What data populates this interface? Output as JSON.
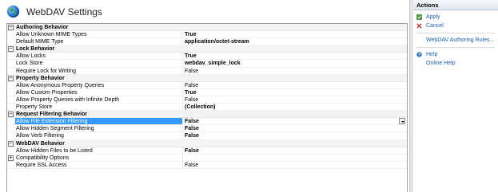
{
  "header": {
    "title": "WebDAV Settings"
  },
  "grid": {
    "categories": [
      {
        "label": "Authoring Behavior",
        "props": [
          {
            "name": "Allow Unknown MIME Types",
            "value": "True",
            "bold": true
          },
          {
            "name": "Default MIME Type",
            "value": "application/octet-stream",
            "bold": true
          }
        ]
      },
      {
        "label": "Lock Behavior",
        "props": [
          {
            "name": "Allow Locks",
            "value": "True",
            "bold": true
          },
          {
            "name": "Lock Store",
            "value": "webdav_simple_lock",
            "bold": true
          },
          {
            "name": "Require Lock for Writing",
            "value": "False",
            "bold": false
          }
        ]
      },
      {
        "label": "Property Behavior",
        "props": [
          {
            "name": "Allow Anonymous Property Queries",
            "value": "False",
            "bold": false
          },
          {
            "name": "Allow Custom Properties",
            "value": "True",
            "bold": true
          },
          {
            "name": "Allow Property Queries with Infinite Depth",
            "value": "False",
            "bold": false
          },
          {
            "name": "Property Store",
            "value": "(Collection)",
            "bold": true
          }
        ]
      },
      {
        "label": "Request Filtering Behavior",
        "props": [
          {
            "name": "Allow File Extension Filtering",
            "value": "False",
            "bold": true,
            "selected": true
          },
          {
            "name": "Allow Hidden Segment Filtering",
            "value": "False",
            "bold": true
          },
          {
            "name": "Allow Verb Filtering",
            "value": "False",
            "bold": true
          }
        ]
      },
      {
        "label": "WebDAV Behavior",
        "props": [
          {
            "name": "Allow Hidden Files to be Listed",
            "value": "False",
            "bold": true
          },
          {
            "name": "Compatibility Options",
            "value": "",
            "bold": false,
            "expandable": true
          },
          {
            "name": "Require SSL Access",
            "value": "False",
            "bold": false
          }
        ]
      }
    ]
  },
  "actions": {
    "title": "Actions",
    "apply": "Apply",
    "cancel": "Cancel",
    "authoring_rules": "WebDAV Authoring Rules...",
    "help": "Help",
    "online_help": "Online Help"
  },
  "colors": {
    "selection": "#3399ff",
    "link": "#1a5fb4",
    "category_bg": "#f3f3f3"
  }
}
